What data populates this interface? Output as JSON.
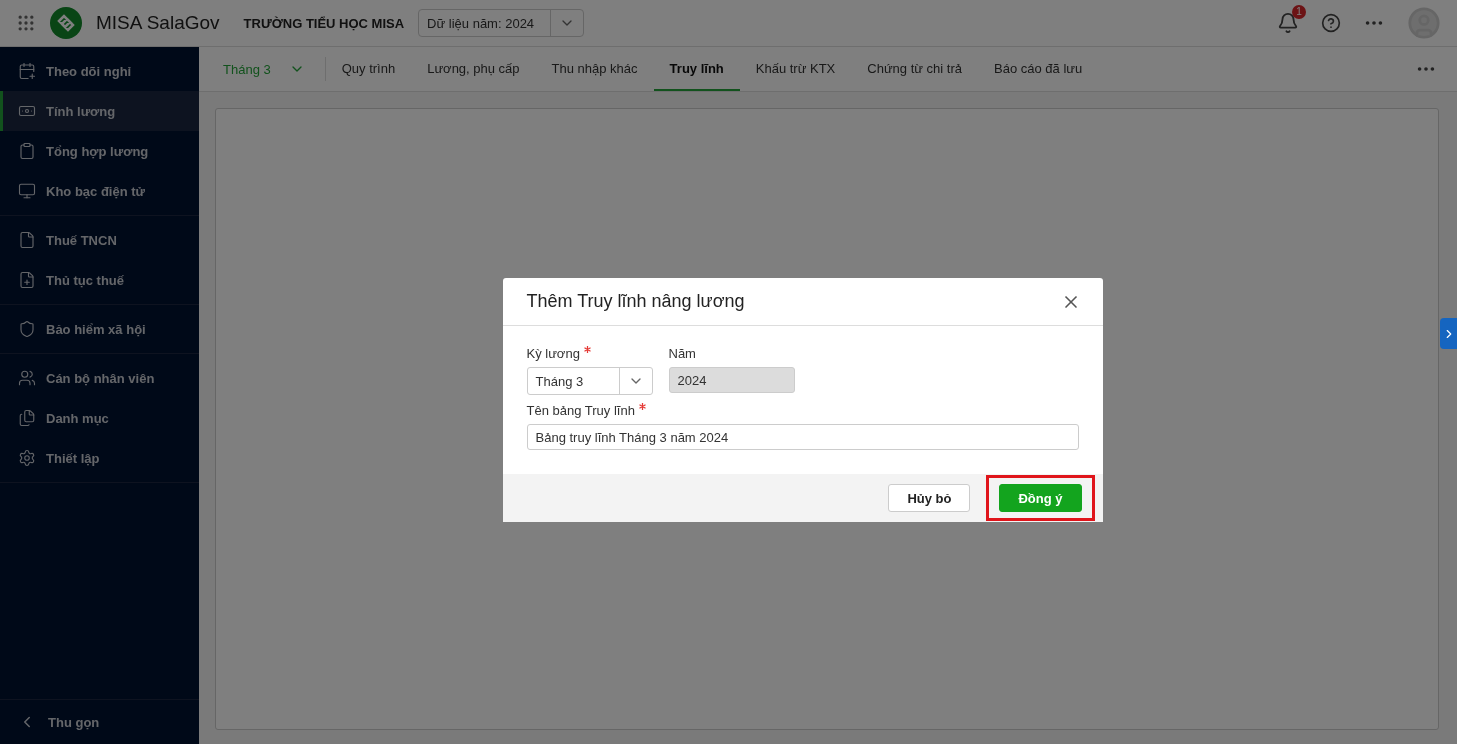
{
  "header": {
    "app_name": "MISA SalaGov",
    "school": "TRƯỜNG TIỂU HỌC MISA",
    "year_select": {
      "value": "Dữ liệu năm: 2024"
    },
    "notification_count": "1"
  },
  "sidebar": {
    "groups": [
      {
        "items": [
          {
            "label": "Theo dõi nghỉ",
            "selected": false
          },
          {
            "label": "Tính lương",
            "selected": true
          },
          {
            "label": "Tổng hợp lương",
            "selected": false
          },
          {
            "label": "Kho bạc điện tử",
            "selected": false
          }
        ]
      },
      {
        "items": [
          {
            "label": "Thuế TNCN",
            "selected": false
          },
          {
            "label": "Thủ tục thuế",
            "selected": false
          }
        ]
      },
      {
        "items": [
          {
            "label": "Bảo hiểm xã hội",
            "selected": false
          }
        ]
      },
      {
        "items": [
          {
            "label": "Cán bộ nhân viên",
            "selected": false
          },
          {
            "label": "Danh mục",
            "selected": false
          },
          {
            "label": "Thiết lập",
            "selected": false
          }
        ]
      }
    ],
    "collapse_label": "Thu gọn"
  },
  "tabs": {
    "period": "Tháng 3",
    "items": [
      {
        "label": "Quy trình",
        "selected": false
      },
      {
        "label": "Lương, phụ cấp",
        "selected": false
      },
      {
        "label": "Thu nhập khác",
        "selected": false
      },
      {
        "label": "Truy lĩnh",
        "selected": true
      },
      {
        "label": "Khấu trừ KTX",
        "selected": false
      },
      {
        "label": "Chứng từ chi trả",
        "selected": false
      },
      {
        "label": "Báo cáo đã lưu",
        "selected": false
      }
    ]
  },
  "dialog": {
    "title": "Thêm Truy lĩnh nâng lương",
    "period": {
      "label": "Kỳ lương",
      "required": true,
      "value": "Tháng 3"
    },
    "year": {
      "label": "Năm",
      "value": "2024",
      "disabled": true
    },
    "name": {
      "label": "Tên bảng Truy lĩnh",
      "required": true,
      "value": "Bảng truy lĩnh Tháng 3 năm 2024"
    },
    "cancel": "Hủy bỏ",
    "confirm": {
      "label": "Đồng ý",
      "highlighted": true
    }
  }
}
